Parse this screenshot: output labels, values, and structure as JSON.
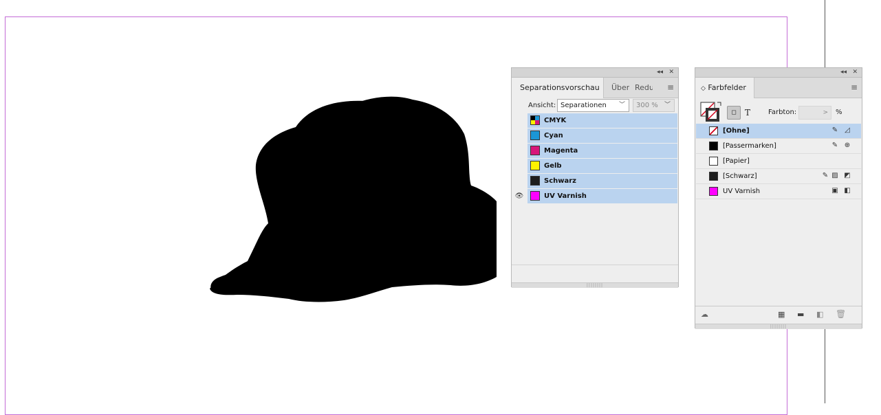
{
  "separations_panel": {
    "tabs": [
      {
        "label": "Separationsvorschau"
      },
      {
        "label": "Über"
      },
      {
        "label": "Reduz"
      }
    ],
    "view_label": "Ansicht:",
    "view_value": "Separationen",
    "zoom_value": "300 %",
    "rows": [
      {
        "name": "CMYK",
        "color": "cmyk",
        "visible": false
      },
      {
        "name": "Cyan",
        "color": "#1b96d6",
        "visible": false
      },
      {
        "name": "Magenta",
        "color": "#d7167a",
        "visible": false
      },
      {
        "name": "Gelb",
        "color": "#fff200",
        "visible": false
      },
      {
        "name": "Schwarz",
        "color": "#1e1e1e",
        "visible": false
      },
      {
        "name": "UV Varnish",
        "color": "#ff00ff",
        "visible": true
      }
    ]
  },
  "swatches_panel": {
    "title": "Farbfelder",
    "tint_label": "Farbton:",
    "tint_value": "",
    "tint_unit": "%",
    "rows": [
      {
        "name": "[Ohne]",
        "color": "none",
        "selected": true
      },
      {
        "name": "[Passermarken]",
        "color": "#000000",
        "selected": false
      },
      {
        "name": "[Papier]",
        "color": "#ffffff",
        "selected": false
      },
      {
        "name": "[Schwarz]",
        "color": "#1e1e1e",
        "selected": false
      },
      {
        "name": "UV Varnish",
        "color": "#ff00ff",
        "selected": false
      }
    ]
  }
}
